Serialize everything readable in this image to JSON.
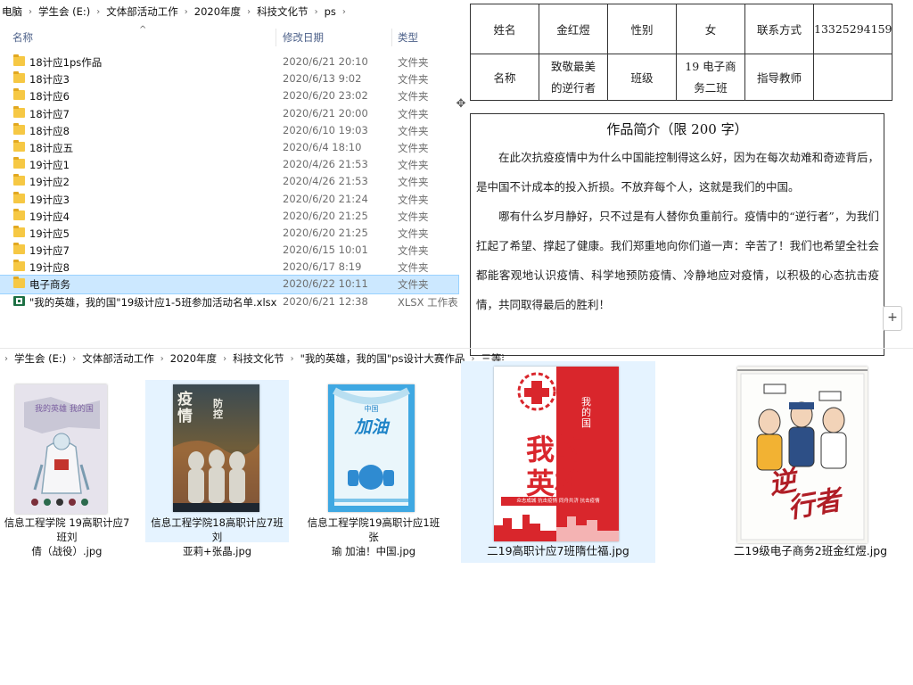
{
  "explorer_top": {
    "breadcrumb": [
      "电脑",
      "学生会 (E:)",
      "文体部活动工作",
      "2020年度",
      "科技文化节",
      "ps"
    ],
    "columns": {
      "name": "名称",
      "date": "修改日期",
      "type": "类型"
    },
    "files": [
      {
        "name": "18计应1ps作品",
        "date": "2020/6/21 20:10",
        "type": "文件夹",
        "kind": "folder"
      },
      {
        "name": "18计应3",
        "date": "2020/6/13 9:02",
        "type": "文件夹",
        "kind": "folder"
      },
      {
        "name": "18计应6",
        "date": "2020/6/20 23:02",
        "type": "文件夹",
        "kind": "folder"
      },
      {
        "name": "18计应7",
        "date": "2020/6/21 20:00",
        "type": "文件夹",
        "kind": "folder"
      },
      {
        "name": "18计应8",
        "date": "2020/6/10 19:03",
        "type": "文件夹",
        "kind": "folder"
      },
      {
        "name": "18计应五",
        "date": "2020/6/4 18:10",
        "type": "文件夹",
        "kind": "folder"
      },
      {
        "name": "19计应1",
        "date": "2020/4/26 21:53",
        "type": "文件夹",
        "kind": "folder"
      },
      {
        "name": "19计应2",
        "date": "2020/4/26 21:53",
        "type": "文件夹",
        "kind": "folder"
      },
      {
        "name": "19计应3",
        "date": "2020/6/20 21:24",
        "type": "文件夹",
        "kind": "folder"
      },
      {
        "name": "19计应4",
        "date": "2020/6/20 21:25",
        "type": "文件夹",
        "kind": "folder"
      },
      {
        "name": "19计应5",
        "date": "2020/6/20 21:25",
        "type": "文件夹",
        "kind": "folder"
      },
      {
        "name": "19计应7",
        "date": "2020/6/15 10:01",
        "type": "文件夹",
        "kind": "folder"
      },
      {
        "name": "19计应8",
        "date": "2020/6/17 8:19",
        "type": "文件夹",
        "kind": "folder"
      },
      {
        "name": "电子商务",
        "date": "2020/6/22 10:11",
        "type": "文件夹",
        "kind": "folder",
        "selected": true
      },
      {
        "name": "\"我的英雄，我的国\"19级计应1-5班参加活动名单.xlsx",
        "date": "2020/6/21 12:38",
        "type": "XLSX 工作表",
        "kind": "xlsx"
      }
    ]
  },
  "document": {
    "row1": {
      "label_name": "姓名",
      "name": "金红煜",
      "label_gender": "性别",
      "gender": "女",
      "label_contact": "联系方式",
      "contact": "13325294159"
    },
    "row2": {
      "label_title": "名称",
      "title_line1": "致敬最美",
      "title_line2": "的逆行者",
      "label_class": "班级",
      "class_line1": "19 电子商",
      "class_line2": "务二班",
      "label_teacher": "指导教师",
      "teacher": ""
    },
    "intro_title": "作品简介（限 200 字）",
    "intro_paragraphs": [
      "在此次抗疫疫情中为什么中国能控制得这么好，因为在每次劫难和奇迹背后，是中国不计成本的投入折损。不放弃每个人，这就是我们的中国。",
      "哪有什么岁月静好，只不过是有人替你负重前行。疫情中的“逆行者”，为我们扛起了希望、撑起了健康。我们郑重地向你们道一声：辛苦了！我们也希望全社会都能客观地认识疫情、科学地预防疫情、冷静地应对疫情，以积极的心态抗击疫情，共同取得最后的胜利！"
    ]
  },
  "explorer_bottom": {
    "breadcrumb": [
      "学生会 (E:)",
      "文体部活动工作",
      "2020年度",
      "科技文化节",
      "\"我的英雄，我的国\"ps设计大赛作品",
      "三等奖"
    ],
    "thumbnails": [
      {
        "caption_line1": "信息工程学院 19高职计应7班刘",
        "caption_line2": "倩（战役）.jpg",
        "poster_text": "我的英雄 我的国"
      },
      {
        "caption_line1": "信息工程学院18高职计应7班 刘",
        "caption_line2": "亚莉+张晶.jpg",
        "poster_text_1": "疫",
        "poster_text_2": "情",
        "poster_text_3": "防",
        "poster_text_4": "控"
      },
      {
        "caption_line1": "信息工程学院19高职计应1班  张",
        "caption_line2": "瑜 加油！中国.jpg",
        "poster_text_1": "中国",
        "poster_text_2": "加油"
      }
    ]
  },
  "thumbs_right": [
    {
      "caption": "二19高职计应7班隋仕福.jpg",
      "poster_text_1": "我的",
      "poster_text_2": "英雄",
      "poster_text_3": "我的国",
      "poster_text_4": "众志成城 抗击疫情 同舟共济 抗击疫情"
    },
    {
      "caption": "二19级电子商务2班金红煜.jpg",
      "poster_text_1": "逆",
      "poster_text_2": "行",
      "poster_text_3": "者"
    }
  ],
  "colors": {
    "selection_bg": "#cce8ff",
    "selection_border": "#99d1ff",
    "folder": "#f6c844",
    "xlsx": "#1d7044",
    "header_text": "#4c6089"
  }
}
